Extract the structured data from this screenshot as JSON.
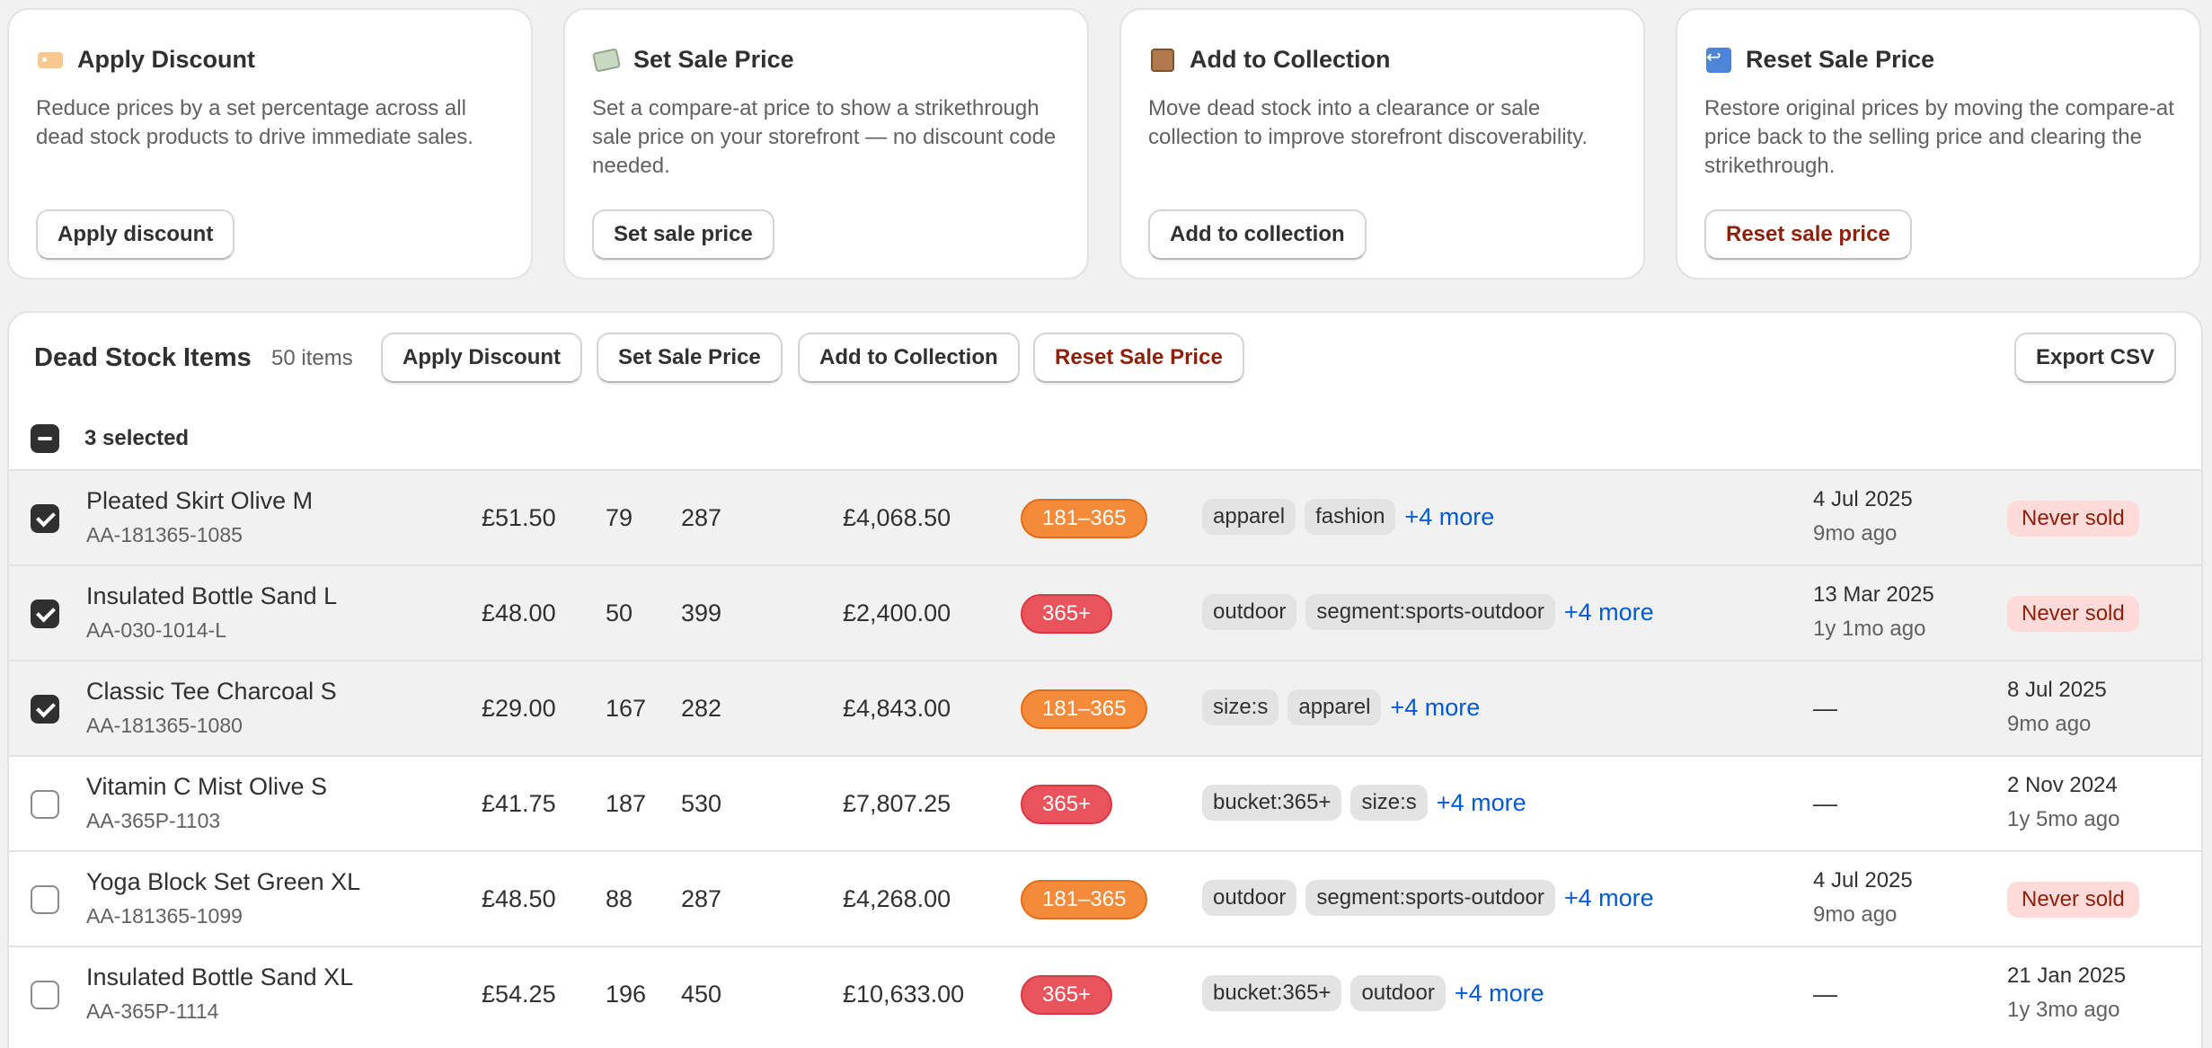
{
  "cards": [
    {
      "title": "Apply Discount",
      "icon": "tag-icon",
      "description": "Reduce prices by a set percentage across all dead stock products to drive immediate sales.",
      "button": "Apply discount",
      "danger": false
    },
    {
      "title": "Set Sale Price",
      "icon": "money-icon",
      "description": "Set a compare-at price to show a strikethrough sale price on your storefront — no discount code needed.",
      "button": "Set sale price",
      "danger": false
    },
    {
      "title": "Add to Collection",
      "icon": "package-icon",
      "description": "Move dead stock into a clearance or sale collection to improve storefront discoverability.",
      "button": "Add to collection",
      "danger": false
    },
    {
      "title": "Reset Sale Price",
      "icon": "return-arrow-icon",
      "description": "Restore original prices by moving the compare-at price back to the selling price and clearing the strikethrough.",
      "button": "Reset sale price",
      "danger": true
    }
  ],
  "table": {
    "title": "Dead Stock Items",
    "count": "50 items",
    "actions": {
      "apply_discount": "Apply Discount",
      "set_sale_price": "Set Sale Price",
      "add_to_collection": "Add to Collection",
      "reset_sale_price": "Reset Sale Price",
      "export_csv": "Export CSV"
    },
    "selection_text": "3 selected",
    "rows": [
      {
        "selected": true,
        "name": "Pleated Skirt Olive M",
        "sku": "AA-181365-1085",
        "price": "£51.50",
        "stock": "79",
        "days": "287",
        "value": "£4,068.50",
        "bucket": "181–365",
        "bucket_type": "181",
        "tags": [
          "apparel",
          "fashion"
        ],
        "more": "+4 more",
        "date_primary": "4 Jul 2025",
        "date_secondary": "9mo ago",
        "last_primary": "Never sold",
        "last_secondary": "",
        "last_is_badge": true
      },
      {
        "selected": true,
        "name": "Insulated Bottle Sand L",
        "sku": "AA-030-1014-L",
        "price": "£48.00",
        "stock": "50",
        "days": "399",
        "value": "£2,400.00",
        "bucket": "365+",
        "bucket_type": "365",
        "tags": [
          "outdoor",
          "segment:sports-outdoor"
        ],
        "more": "+4 more",
        "date_primary": "13 Mar 2025",
        "date_secondary": "1y 1mo ago",
        "last_primary": "Never sold",
        "last_secondary": "",
        "last_is_badge": true
      },
      {
        "selected": true,
        "name": "Classic Tee Charcoal S",
        "sku": "AA-181365-1080",
        "price": "£29.00",
        "stock": "167",
        "days": "282",
        "value": "£4,843.00",
        "bucket": "181–365",
        "bucket_type": "181",
        "tags": [
          "size:s",
          "apparel"
        ],
        "more": "+4 more",
        "date_primary": "—",
        "date_secondary": "",
        "last_primary": "8 Jul 2025",
        "last_secondary": "9mo ago",
        "last_is_badge": false
      },
      {
        "selected": false,
        "name": "Vitamin C Mist Olive S",
        "sku": "AA-365P-1103",
        "price": "£41.75",
        "stock": "187",
        "days": "530",
        "value": "£7,807.25",
        "bucket": "365+",
        "bucket_type": "365",
        "tags": [
          "bucket:365+",
          "size:s"
        ],
        "more": "+4 more",
        "date_primary": "—",
        "date_secondary": "",
        "last_primary": "2 Nov 2024",
        "last_secondary": "1y 5mo ago",
        "last_is_badge": false
      },
      {
        "selected": false,
        "name": "Yoga Block Set Green XL",
        "sku": "AA-181365-1099",
        "price": "£48.50",
        "stock": "88",
        "days": "287",
        "value": "£4,268.00",
        "bucket": "181–365",
        "bucket_type": "181",
        "tags": [
          "outdoor",
          "segment:sports-outdoor"
        ],
        "more": "+4 more",
        "date_primary": "4 Jul 2025",
        "date_secondary": "9mo ago",
        "last_primary": "Never sold",
        "last_secondary": "",
        "last_is_badge": true
      },
      {
        "selected": false,
        "name": "Insulated Bottle Sand XL",
        "sku": "AA-365P-1114",
        "price": "£54.25",
        "stock": "196",
        "days": "450",
        "value": "£10,633.00",
        "bucket": "365+",
        "bucket_type": "365",
        "tags": [
          "bucket:365+",
          "outdoor"
        ],
        "more": "+4 more",
        "date_primary": "—",
        "date_secondary": "",
        "last_primary": "21 Jan 2025",
        "last_secondary": "1y 3mo ago",
        "last_is_badge": false
      }
    ]
  },
  "colors": {
    "bucket_181": "#f48b3a",
    "bucket_365": "#e9545c",
    "link": "#005bd3",
    "danger_text": "#8e1f0b",
    "never_sold_bg": "#fedad9"
  }
}
